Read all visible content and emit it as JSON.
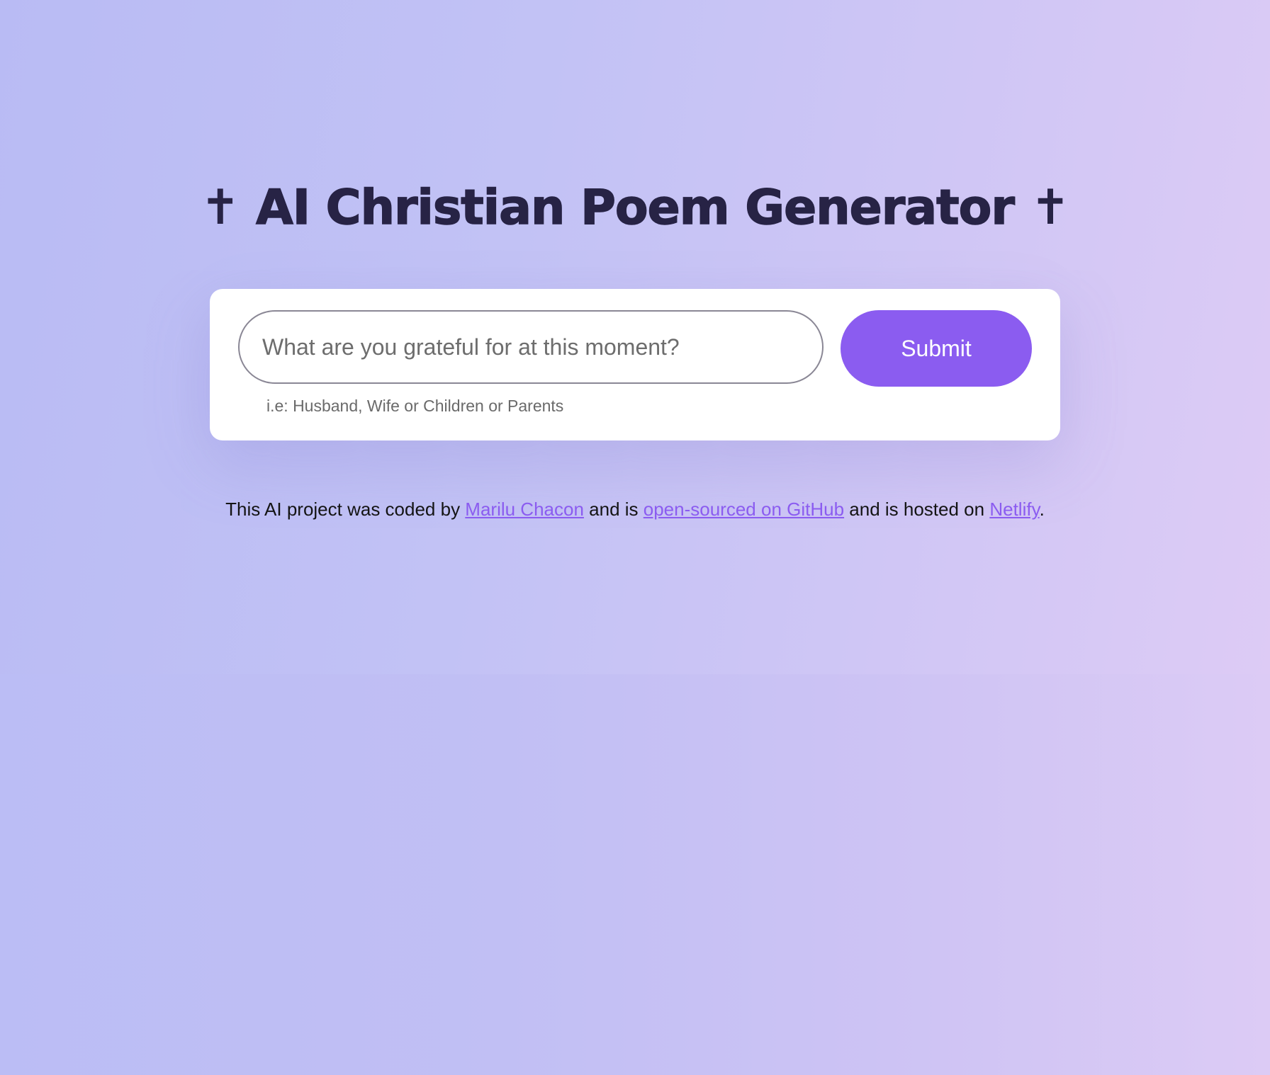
{
  "header": {
    "title": "AI Christian Poem Generator",
    "cross_glyph": "✝"
  },
  "form": {
    "input_placeholder": "What are you grateful for at this moment?",
    "input_value": "",
    "submit_label": "Submit",
    "hint": "i.e: Husband, Wife or Children or Parents"
  },
  "footer": {
    "text_before": "This AI project was coded by ",
    "author_link": "Marilu Chacon",
    "text_middle": " and is ",
    "github_link": "open-sourced on GitHub",
    "text_after": " and is hosted on ",
    "netlify_link": "Netlify",
    "text_end": "."
  },
  "colors": {
    "accent": "#8b5cf0",
    "title": "#272345",
    "background_left": "#bbbdf5",
    "background_right": "#dccbf5"
  }
}
